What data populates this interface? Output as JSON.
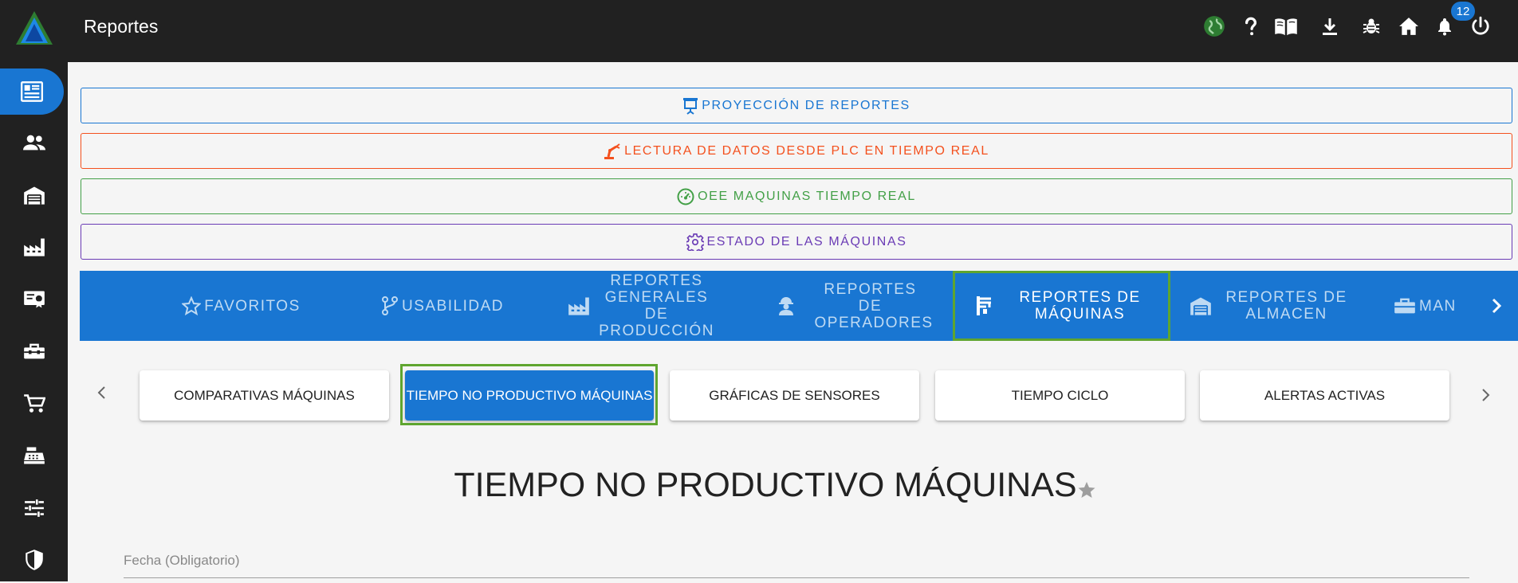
{
  "header": {
    "title": "Reportes",
    "notifications_count": "12",
    "icons": [
      "globe-icon",
      "help-icon",
      "manual-icon",
      "download-icon",
      "bug-icon",
      "home-icon",
      "bell-icon",
      "power-icon"
    ]
  },
  "sidebar": {
    "items": [
      "reports-icon",
      "users-icon",
      "warehouse-icon",
      "factory-icon",
      "certificate-icon",
      "toolbox-icon",
      "cart-icon",
      "cash-register-icon",
      "sliders-icon",
      "shield-icon"
    ]
  },
  "actions": {
    "projection": "PROYECCIÓN DE REPORTES",
    "plc": "LECTURA DE DATOS DESDE PLC EN TIEMPO REAL",
    "oee": "OEE MAQUINAS TIEMPO REAL",
    "machine_state": "ESTADO DE LAS MÁQUINAS"
  },
  "categories": {
    "favoritos": "FAVORITOS",
    "usabilidad": "USABILIDAD",
    "produccion": "REPORTES GENERALES DE PRODUCCIÓN",
    "operadores": "REPORTES DE OPERADORES",
    "maquinas": "REPORTES DE MÁQUINAS",
    "almacen": "REPORTES DE ALMACEN",
    "man": "MAN"
  },
  "subtabs": {
    "comparativas": "COMPARATIVAS MÁQUINAS",
    "tiempo_no_productivo": "TIEMPO NO PRODUCTIVO MÁQUINAS",
    "graficas": "GRÁFICAS DE SENSORES",
    "tiempo_ciclo": "TIEMPO CICLO",
    "alertas": "ALERTAS ACTIVAS"
  },
  "page": {
    "title": "TIEMPO NO PRODUCTIVO MÁQUINAS",
    "date_label": "Fecha (Obligatorio)"
  },
  "colors": {
    "primary": "#1976d2",
    "projection": "#1976d2",
    "plc": "#f4511e",
    "oee": "#43a047",
    "machine_state": "#6a3bb5",
    "highlight": "#5fa52f"
  }
}
